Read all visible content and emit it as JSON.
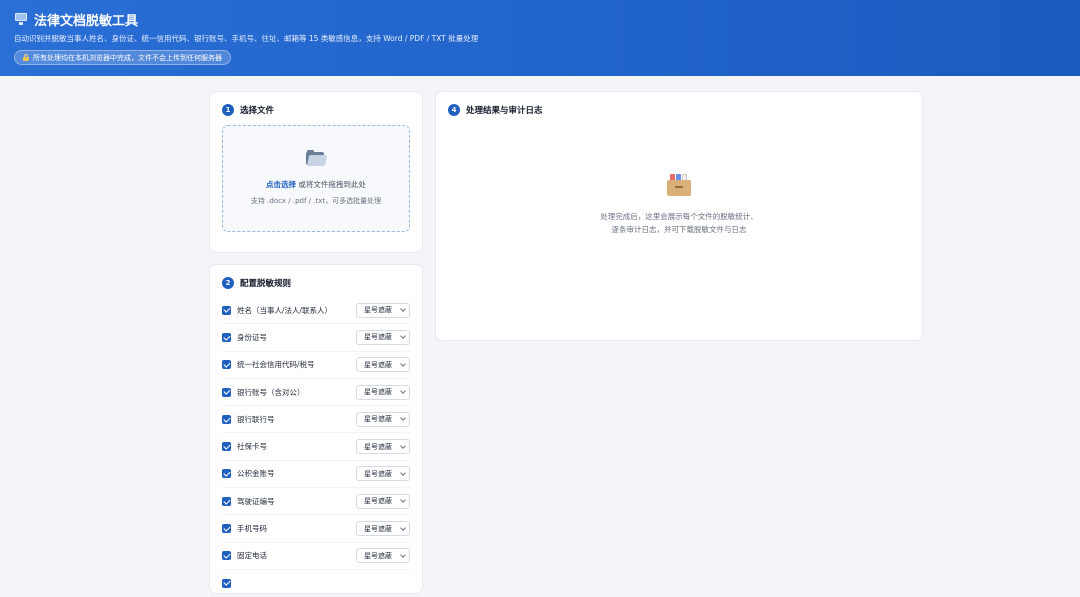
{
  "header": {
    "title": "法律文档脱敏工具",
    "subtitle": "自动识别并脱敏当事人姓名、身份证、统一信用代码、银行账号、手机号、住址、邮箱等 15 类敏感信息，支持 Word / PDF / TXT 批量处理",
    "privacy_note": "所有处理均在本机浏览器中完成，文件不会上传到任何服务器",
    "icons": {
      "title": "computer-icon",
      "privacy": "lock-icon"
    },
    "colors": {
      "gradient_start": "#2a6fd6",
      "gradient_end": "#1c5bbf"
    }
  },
  "file_card": {
    "step": "1",
    "title": "选择文件",
    "icon": "folder-icon",
    "click_label": "点击选择",
    "drag_text": " 或将文件拖拽到此处",
    "hint": "支持 .docx / .pdf / .txt，可多选批量处理"
  },
  "rules_card": {
    "step": "2",
    "title": "配置脱敏规则",
    "rules": [
      {
        "label": "姓名（当事人/法人/联系人）",
        "checked": true,
        "mode": "星号遮蔽"
      },
      {
        "label": "身份证号",
        "checked": true,
        "mode": "星号遮蔽"
      },
      {
        "label": "统一社会信用代码/税号",
        "checked": true,
        "mode": "星号遮蔽"
      },
      {
        "label": "银行账号（含对公）",
        "checked": true,
        "mode": "星号遮蔽"
      },
      {
        "label": "银行联行号",
        "checked": true,
        "mode": "星号遮蔽"
      },
      {
        "label": "社保卡号",
        "checked": true,
        "mode": "星号遮蔽"
      },
      {
        "label": "公积金账号",
        "checked": true,
        "mode": "星号遮蔽"
      },
      {
        "label": "驾驶证编号",
        "checked": true,
        "mode": "星号遮蔽"
      },
      {
        "label": "手机号码",
        "checked": true,
        "mode": "星号遮蔽"
      },
      {
        "label": "固定电话",
        "checked": true,
        "mode": "星号遮蔽"
      },
      {
        "label": "",
        "checked": true,
        "mode": ""
      }
    ]
  },
  "result_card": {
    "step": "4",
    "title": "处理结果与审计日志",
    "icon": "card-box-icon",
    "empty_line1": "处理完成后，这里会展示每个文件的脱敏统计、",
    "empty_line2": "逐条审计日志，并可下载脱敏文件与日志"
  }
}
